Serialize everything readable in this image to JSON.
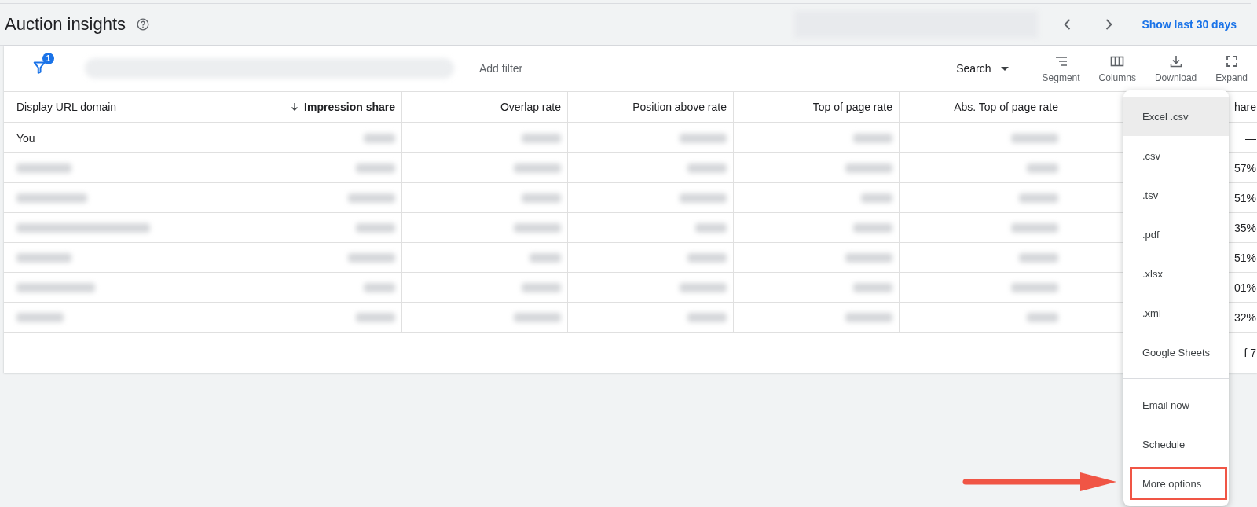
{
  "header": {
    "title": "Auction insights",
    "nav_link": "Show last 30 days"
  },
  "toolbar": {
    "filter_count": "1",
    "add_filter": "Add filter",
    "search": "Search",
    "tools": [
      {
        "kind": "segment",
        "label": "Segment"
      },
      {
        "kind": "columns",
        "label": "Columns"
      },
      {
        "kind": "download",
        "label": "Download"
      },
      {
        "kind": "expand",
        "label": "Expand"
      }
    ]
  },
  "table": {
    "columns": [
      {
        "label": "Display URL domain",
        "sorted": false
      },
      {
        "label": "Impression share",
        "sorted": true
      },
      {
        "label": "Overlap rate",
        "sorted": false
      },
      {
        "label": "Position above rate",
        "sorted": false
      },
      {
        "label": "Top of page rate",
        "sorted": false
      },
      {
        "label": "Abs. Top of page rate",
        "sorted": false
      },
      {
        "label": "hare",
        "sorted": false
      }
    ],
    "rows": [
      {
        "domain": "You",
        "column_7": "—"
      },
      {
        "column_7": "57%"
      },
      {
        "column_7": "51%"
      },
      {
        "column_7": "35%"
      },
      {
        "column_7": "51%"
      },
      {
        "column_7": "01%"
      },
      {
        "column_7": "32%"
      }
    ],
    "footer": "f 7"
  },
  "download_menu": {
    "groups": [
      [
        {
          "label": "Excel .csv",
          "highlighted": true,
          "annotated": false
        },
        {
          "label": ".csv",
          "highlighted": false,
          "annotated": false
        },
        {
          "label": ".tsv",
          "highlighted": false,
          "annotated": false
        },
        {
          "label": ".pdf",
          "highlighted": false,
          "annotated": false
        },
        {
          "label": ".xlsx",
          "highlighted": false,
          "annotated": false
        },
        {
          "label": ".xml",
          "highlighted": false,
          "annotated": false
        },
        {
          "label": "Google Sheets",
          "highlighted": false,
          "annotated": false
        }
      ],
      [
        {
          "label": "Email now",
          "highlighted": false,
          "annotated": false
        },
        {
          "label": "Schedule",
          "highlighted": false,
          "annotated": false
        },
        {
          "label": "More options",
          "highlighted": false,
          "annotated": true
        }
      ]
    ]
  }
}
